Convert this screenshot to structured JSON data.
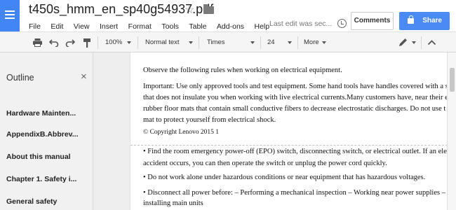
{
  "header": {
    "title": "t450s_hmm_en_sp40g54937.pdf",
    "menu": [
      "File",
      "Edit",
      "View",
      "Insert",
      "Format",
      "Tools",
      "Table",
      "Add-ons",
      "Help"
    ],
    "last_edit": "Last edit was sec...",
    "comments_label": "Comments",
    "share_label": "Share"
  },
  "toolbar": {
    "zoom": "100%",
    "style": "Normal text",
    "font": "Times",
    "size": "24",
    "more": "More"
  },
  "outline": {
    "title": "Outline",
    "items": [
      "Hardware Mainten...",
      "AppendixB.Abbrev...",
      "About this manual",
      "Chapter 1. Safety i...",
      "General safety"
    ]
  },
  "document": {
    "lines": [
      "Observe the following rules when working on electrical equipment.",
      "Important: Use only approved tools and test equipment. Some hand tools have handles covered with a s",
      "that does not insulate you when working with live electrical currents.Many customers have, near their e",
      "rubber floor mats that contain small conductive fibers to decrease electrostatic discharges. Do not use t",
      "mat to protect yourself from electrical shock.",
      "© Copyright Lenovo 2015 1",
      "• Find the room emergency power-off (EPO) switch, disconnecting switch, or electrical outlet. If an ele",
      "accident occurs, you can then operate the switch or unplug the power cord quickly.",
      "• Do not work alone under hazardous conditions or near equipment that has hazardous voltages.",
      "• Disconnect all power before: – Performing a mechanical inspection – Working near power supplies –",
      "installing main units"
    ]
  },
  "colors": {
    "accent": "#4285f4",
    "share": "#4a8af4"
  }
}
